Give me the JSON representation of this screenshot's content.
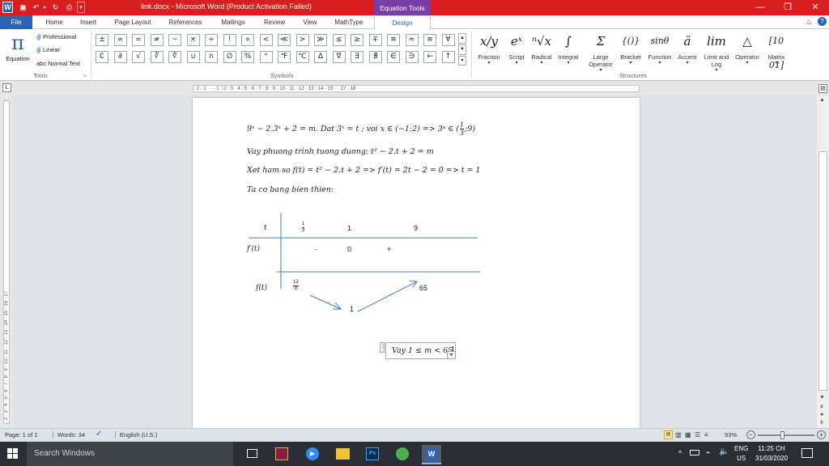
{
  "window": {
    "doc_title": "link.docx - Microsoft Word (Product Activation Failed)",
    "context_tab_title": "Equation Tools"
  },
  "ribbon_tabs": [
    "File",
    "Home",
    "Insert",
    "Page Layout",
    "References",
    "Mailings",
    "Review",
    "View",
    "MathType",
    "Design"
  ],
  "tools_group": {
    "equation_label": "Equation",
    "professional": "Professional",
    "linear": "Linear",
    "normal_text": "abc Normal Text",
    "group_label": "Tools"
  },
  "symbols": {
    "row1": [
      "±",
      "∞",
      "=",
      "≠",
      "~",
      "×",
      "÷",
      "!",
      "∝",
      "<",
      "≪",
      ">",
      "≫",
      "≤",
      "≥",
      "∓",
      "≅",
      "≈",
      "≡",
      "∀"
    ],
    "row2": [
      "∁",
      "∂",
      "√",
      "∛",
      "∜",
      "∪",
      "∩",
      "∅",
      "%",
      "°",
      "℉",
      "℃",
      "∆",
      "∇",
      "∃",
      "∄",
      "∈",
      "∋",
      "←",
      "↑"
    ],
    "group_label": "Symbols"
  },
  "structures": {
    "items": [
      {
        "label": "Fraction",
        "glyph": "x/y",
        "has_arrow": true
      },
      {
        "label": "Script",
        "glyph": "eˣ",
        "has_arrow": true
      },
      {
        "label": "Radical",
        "glyph": "ⁿ√x",
        "has_arrow": true
      },
      {
        "label": "Integral",
        "glyph": "∫",
        "has_arrow": true
      },
      {
        "label": "Large Operator",
        "glyph": "Σ",
        "has_arrow": true
      },
      {
        "label": "Bracket",
        "glyph": "{()}",
        "has_arrow": true
      },
      {
        "label": "Function",
        "glyph": "sinθ",
        "has_arrow": true
      },
      {
        "label": "Accent",
        "glyph": "ä",
        "has_arrow": true
      },
      {
        "label": "Limit and Log",
        "glyph": "lim",
        "has_arrow": true
      },
      {
        "label": "Operator",
        "glyph": "△",
        "has_arrow": true
      },
      {
        "label": "Matrix",
        "glyph": "[10 01]",
        "has_arrow": true
      }
    ],
    "group_label": "Structures"
  },
  "ruler_ticks": "· 2 · 1 · · · 1 · 2 · 3 · 4 · 5 · 6 · 7 · 8 · 9 · 10 · 11 · 12 · 13 · 14 · 15 · · 17 · 18 ·",
  "vruler_ticks": "· 2 · 3 · 4 · 5 · 6 · 7 · 8 · 9 · 10 · 11 · 12 · 13 · 14 · 15 · 16 · 17",
  "document": {
    "line1_main": "9ˣ − 2.3ˣ + 2 = m. Dat 3ˣ = t ; voi x ∈ (−1;2) => 3ˣ ∈ (",
    "line1_frac_num": "1",
    "line1_frac_den": "3",
    "line1_tail": ";9)",
    "line2": "Vay phuong trinh tuong duong: t² − 2.t + 2 = m",
    "line3": "Xet ham so f(t) = t² − 2.t + 2 => f′(t) = 2t − 2 = 0 => t = 1",
    "line4": "Ta co bang bien thien:",
    "table": {
      "t_label": "t",
      "t1_num": "1",
      "t1_den": "3",
      "t2": "1",
      "t3": "9",
      "fprime_label": "f′(t)",
      "sign1": "-",
      "zero": "0",
      "sign2": "+",
      "f_label": "f(t)",
      "f_left_num": "13",
      "f_left_den": "9",
      "f_min": "1",
      "f_right": "65"
    },
    "answer": "Vay 1 ≤ m < 65"
  },
  "statusbar": {
    "page": "Page: 1 of 1",
    "words": "Words: 34",
    "language": "English (U.S.)",
    "zoom": "93%"
  },
  "taskbar": {
    "search_placeholder": "Search Windows",
    "lang_top": "ENG",
    "lang_bottom": "US",
    "time": "11:25 CH",
    "date": "31/03/2020"
  },
  "colors": {
    "titlebar": "#d81e1e",
    "context": "#7a3da8",
    "file_tab": "#2a63b8",
    "table_line": "#4a7ab8"
  }
}
